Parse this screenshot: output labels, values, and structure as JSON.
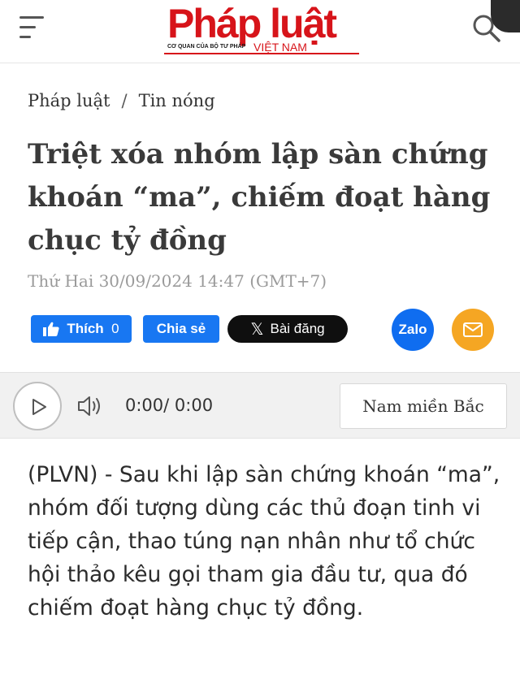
{
  "header": {
    "logo_main": "Pháp luật",
    "logo_tagline": "CƠ QUAN CỦA BỘ TƯ PHÁP",
    "logo_country": "VIỆT NAM",
    "brand_color": "#d7141a",
    "menu_icon": "hamburger-icon",
    "search_icon": "search-icon"
  },
  "breadcrumb": {
    "items": [
      "Pháp luật",
      "Tin nóng"
    ],
    "separator": "/"
  },
  "article": {
    "title": "Triệt xóa nhóm lập sàn chứng khoán “ma”, chiếm đoạt hàng chục tỷ đồng",
    "date": "Thứ Hai 30/09/2024 14:47 (GMT+7)",
    "sapo": "(PLVN) - Sau khi lập sàn chứng khoán “ma”, nhóm đối tượng dùng các thủ đoạn tinh vi tiếp cận, thao túng nạn nhân như tổ chức hội thảo kêu gọi tham gia đầu tư, qua đó chiếm đoạt hàng chục tỷ đồng."
  },
  "social": {
    "like_label": "Thích",
    "like_count": "0",
    "share_label": "Chia sẻ",
    "x_label": "Bài đăng",
    "zalo_label": "Zalo",
    "facebook_color": "#1877f2",
    "zalo_color": "#0f6df0",
    "mail_color": "#f5a623"
  },
  "player": {
    "time": "0:00/ 0:00",
    "voice": "Nam miền Bắc",
    "play_icon": "play-icon",
    "volume_icon": "volume-icon"
  }
}
